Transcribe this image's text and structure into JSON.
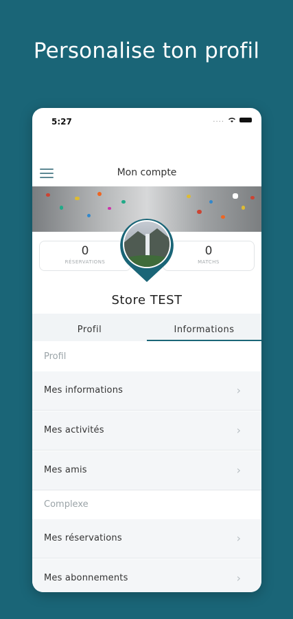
{
  "headline": "Personalise ton profil",
  "status": {
    "time": "5:27",
    "dots": "....",
    "wifi_icon": "wifi-icon",
    "battery_icon": "battery-icon"
  },
  "nav": {
    "menu_icon": "hamburger-menu-icon",
    "title": "Mon compte"
  },
  "stats": [
    {
      "value": "0",
      "label": "RÉSERVATIONS"
    },
    {
      "value": "0",
      "label": "MATCHS"
    }
  ],
  "profile": {
    "name": "Store TEST"
  },
  "tabs": [
    {
      "label": "Profil",
      "active": false
    },
    {
      "label": "Informations",
      "active": true
    }
  ],
  "sections": [
    {
      "header": "Profil",
      "items": [
        "Mes informations",
        "Mes activités",
        "Mes amis"
      ]
    },
    {
      "header": "Complexe",
      "items": [
        "Mes réservations",
        "Mes abonnements"
      ]
    }
  ],
  "colors": {
    "background": "#1a6577",
    "accent": "#1a6577",
    "list_bg": "#f4f6f8"
  }
}
